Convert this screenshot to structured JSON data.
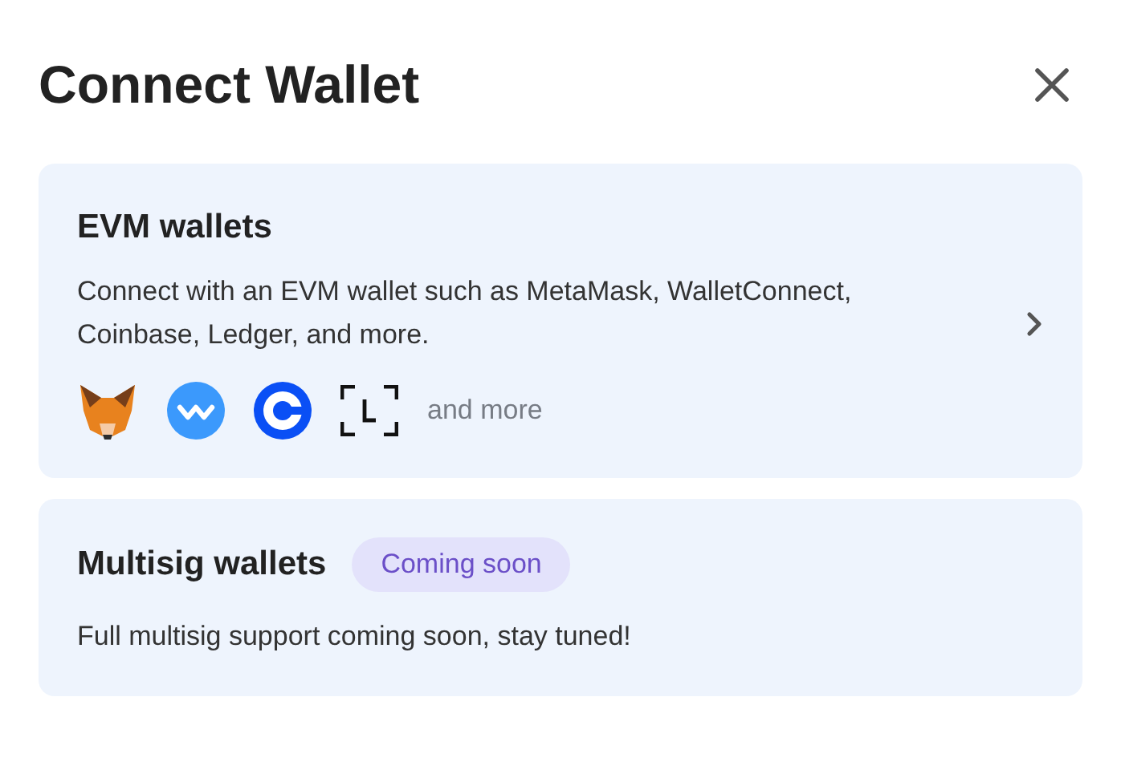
{
  "dialog": {
    "title": "Connect Wallet"
  },
  "options": [
    {
      "kind": "link",
      "title": "EVM wallets",
      "description": "Connect with an EVM wallet such as MetaMask, WalletConnect, Coinbase, Ledger, and more.",
      "logos": [
        {
          "kind": "fox"
        },
        {
          "kind": "wave"
        },
        {
          "kind": "coin"
        },
        {
          "kind": "ledger"
        }
      ],
      "more": "and more"
    },
    {
      "kind": "soon",
      "title": "Multisig wallets",
      "badge": "Coming soon",
      "description": "Full multisig support coming soon, stay tuned!"
    }
  ]
}
